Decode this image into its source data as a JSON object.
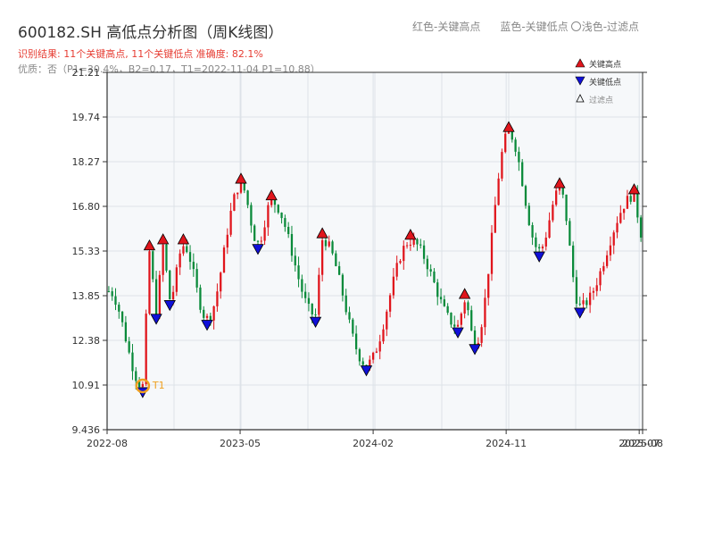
{
  "header": {
    "title": "600182.SH 高低点分析图（周K线图）",
    "subtitle": "识别结果: 11个关键高点, 11个关键低点   准确度: 82.1%",
    "note": "优质：否（P1=30.4%，B2=0.17，T1=2022-11-04 P1=10.88）",
    "top_legend": {
      "red": "红色-关键高点",
      "blue": "蓝色-关键低点",
      "light": "浅色-过滤点"
    }
  },
  "colors": {
    "up": "#e0151c",
    "down": "#0a8a3a",
    "high_marker": "#e0151c",
    "low_marker": "#1010d8",
    "t1": "#f0a020",
    "plot_bg": "#f6f8fa",
    "grid": "#dde2e8"
  },
  "chart_data": {
    "type": "candlestick",
    "title": "600182.SH 高低点分析图（周K线图）",
    "y_ticks": [
      "9.436",
      "10.91",
      "12.38",
      "13.85",
      "15.33",
      "16.80",
      "18.27",
      "19.74",
      "21.21"
    ],
    "ylim": [
      9.436,
      21.21
    ],
    "x_ticks": [
      "2022-08",
      "2023-05",
      "2024-02",
      "2024-11",
      "2025-07",
      "2025-08"
    ],
    "x_tick_weeks": [
      0,
      39,
      78,
      117,
      156,
      157
    ],
    "n_weeks": 158,
    "grid": true,
    "legend": {
      "position": "top-right",
      "items": [
        "关键高点",
        "关键低点",
        "过滤点"
      ]
    },
    "t1_label": "T1",
    "t1": {
      "week": 10,
      "price": 10.88
    },
    "key_points": [
      {
        "type": "low",
        "week": 10,
        "price": 10.88
      },
      {
        "type": "high",
        "week": 12,
        "price": 15.3
      },
      {
        "type": "low",
        "week": 14,
        "price": 13.3
      },
      {
        "type": "high",
        "week": 16,
        "price": 15.5
      },
      {
        "type": "low",
        "week": 18,
        "price": 13.75
      },
      {
        "type": "high",
        "week": 22,
        "price": 15.5
      },
      {
        "type": "low",
        "week": 29,
        "price": 13.1
      },
      {
        "type": "high",
        "week": 39,
        "price": 17.5
      },
      {
        "type": "low",
        "week": 44,
        "price": 15.6
      },
      {
        "type": "high",
        "week": 48,
        "price": 16.95
      },
      {
        "type": "low",
        "week": 61,
        "price": 13.2
      },
      {
        "type": "high",
        "week": 63,
        "price": 15.7
      },
      {
        "type": "low",
        "week": 76,
        "price": 11.6
      },
      {
        "type": "high",
        "week": 89,
        "price": 15.65
      },
      {
        "type": "high",
        "week": 105,
        "price": 13.7
      },
      {
        "type": "low",
        "week": 103,
        "price": 12.85
      },
      {
        "type": "low",
        "week": 108,
        "price": 12.3
      },
      {
        "type": "high",
        "week": 118,
        "price": 19.2
      },
      {
        "type": "low",
        "week": 127,
        "price": 15.35
      },
      {
        "type": "high",
        "week": 133,
        "price": 17.35
      },
      {
        "type": "low",
        "week": 139,
        "price": 13.5
      },
      {
        "type": "high",
        "week": 155,
        "price": 17.15
      }
    ]
  }
}
